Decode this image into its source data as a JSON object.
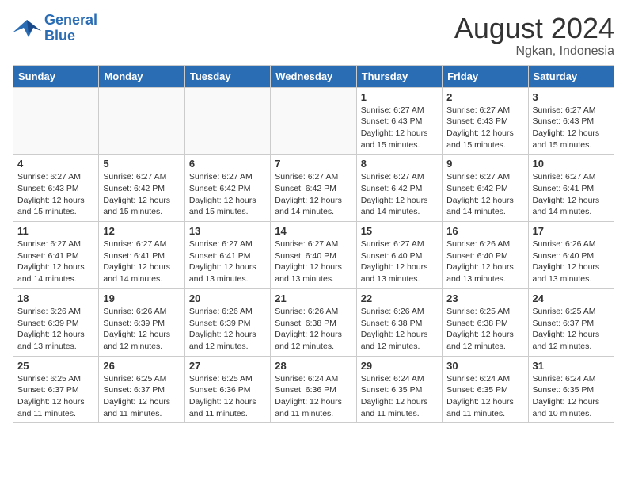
{
  "header": {
    "logo_line1": "General",
    "logo_line2": "Blue",
    "month_year": "August 2024",
    "location": "Ngkan, Indonesia"
  },
  "weekdays": [
    "Sunday",
    "Monday",
    "Tuesday",
    "Wednesday",
    "Thursday",
    "Friday",
    "Saturday"
  ],
  "weeks": [
    [
      {
        "day": "",
        "info": ""
      },
      {
        "day": "",
        "info": ""
      },
      {
        "day": "",
        "info": ""
      },
      {
        "day": "",
        "info": ""
      },
      {
        "day": "1",
        "info": "Sunrise: 6:27 AM\nSunset: 6:43 PM\nDaylight: 12 hours\nand 15 minutes."
      },
      {
        "day": "2",
        "info": "Sunrise: 6:27 AM\nSunset: 6:43 PM\nDaylight: 12 hours\nand 15 minutes."
      },
      {
        "day": "3",
        "info": "Sunrise: 6:27 AM\nSunset: 6:43 PM\nDaylight: 12 hours\nand 15 minutes."
      }
    ],
    [
      {
        "day": "4",
        "info": "Sunrise: 6:27 AM\nSunset: 6:43 PM\nDaylight: 12 hours\nand 15 minutes."
      },
      {
        "day": "5",
        "info": "Sunrise: 6:27 AM\nSunset: 6:42 PM\nDaylight: 12 hours\nand 15 minutes."
      },
      {
        "day": "6",
        "info": "Sunrise: 6:27 AM\nSunset: 6:42 PM\nDaylight: 12 hours\nand 15 minutes."
      },
      {
        "day": "7",
        "info": "Sunrise: 6:27 AM\nSunset: 6:42 PM\nDaylight: 12 hours\nand 14 minutes."
      },
      {
        "day": "8",
        "info": "Sunrise: 6:27 AM\nSunset: 6:42 PM\nDaylight: 12 hours\nand 14 minutes."
      },
      {
        "day": "9",
        "info": "Sunrise: 6:27 AM\nSunset: 6:42 PM\nDaylight: 12 hours\nand 14 minutes."
      },
      {
        "day": "10",
        "info": "Sunrise: 6:27 AM\nSunset: 6:41 PM\nDaylight: 12 hours\nand 14 minutes."
      }
    ],
    [
      {
        "day": "11",
        "info": "Sunrise: 6:27 AM\nSunset: 6:41 PM\nDaylight: 12 hours\nand 14 minutes."
      },
      {
        "day": "12",
        "info": "Sunrise: 6:27 AM\nSunset: 6:41 PM\nDaylight: 12 hours\nand 14 minutes."
      },
      {
        "day": "13",
        "info": "Sunrise: 6:27 AM\nSunset: 6:41 PM\nDaylight: 12 hours\nand 13 minutes."
      },
      {
        "day": "14",
        "info": "Sunrise: 6:27 AM\nSunset: 6:40 PM\nDaylight: 12 hours\nand 13 minutes."
      },
      {
        "day": "15",
        "info": "Sunrise: 6:27 AM\nSunset: 6:40 PM\nDaylight: 12 hours\nand 13 minutes."
      },
      {
        "day": "16",
        "info": "Sunrise: 6:26 AM\nSunset: 6:40 PM\nDaylight: 12 hours\nand 13 minutes."
      },
      {
        "day": "17",
        "info": "Sunrise: 6:26 AM\nSunset: 6:40 PM\nDaylight: 12 hours\nand 13 minutes."
      }
    ],
    [
      {
        "day": "18",
        "info": "Sunrise: 6:26 AM\nSunset: 6:39 PM\nDaylight: 12 hours\nand 13 minutes."
      },
      {
        "day": "19",
        "info": "Sunrise: 6:26 AM\nSunset: 6:39 PM\nDaylight: 12 hours\nand 12 minutes."
      },
      {
        "day": "20",
        "info": "Sunrise: 6:26 AM\nSunset: 6:39 PM\nDaylight: 12 hours\nand 12 minutes."
      },
      {
        "day": "21",
        "info": "Sunrise: 6:26 AM\nSunset: 6:38 PM\nDaylight: 12 hours\nand 12 minutes."
      },
      {
        "day": "22",
        "info": "Sunrise: 6:26 AM\nSunset: 6:38 PM\nDaylight: 12 hours\nand 12 minutes."
      },
      {
        "day": "23",
        "info": "Sunrise: 6:25 AM\nSunset: 6:38 PM\nDaylight: 12 hours\nand 12 minutes."
      },
      {
        "day": "24",
        "info": "Sunrise: 6:25 AM\nSunset: 6:37 PM\nDaylight: 12 hours\nand 12 minutes."
      }
    ],
    [
      {
        "day": "25",
        "info": "Sunrise: 6:25 AM\nSunset: 6:37 PM\nDaylight: 12 hours\nand 11 minutes."
      },
      {
        "day": "26",
        "info": "Sunrise: 6:25 AM\nSunset: 6:37 PM\nDaylight: 12 hours\nand 11 minutes."
      },
      {
        "day": "27",
        "info": "Sunrise: 6:25 AM\nSunset: 6:36 PM\nDaylight: 12 hours\nand 11 minutes."
      },
      {
        "day": "28",
        "info": "Sunrise: 6:24 AM\nSunset: 6:36 PM\nDaylight: 12 hours\nand 11 minutes."
      },
      {
        "day": "29",
        "info": "Sunrise: 6:24 AM\nSunset: 6:35 PM\nDaylight: 12 hours\nand 11 minutes."
      },
      {
        "day": "30",
        "info": "Sunrise: 6:24 AM\nSunset: 6:35 PM\nDaylight: 12 hours\nand 11 minutes."
      },
      {
        "day": "31",
        "info": "Sunrise: 6:24 AM\nSunset: 6:35 PM\nDaylight: 12 hours\nand 10 minutes."
      }
    ]
  ]
}
